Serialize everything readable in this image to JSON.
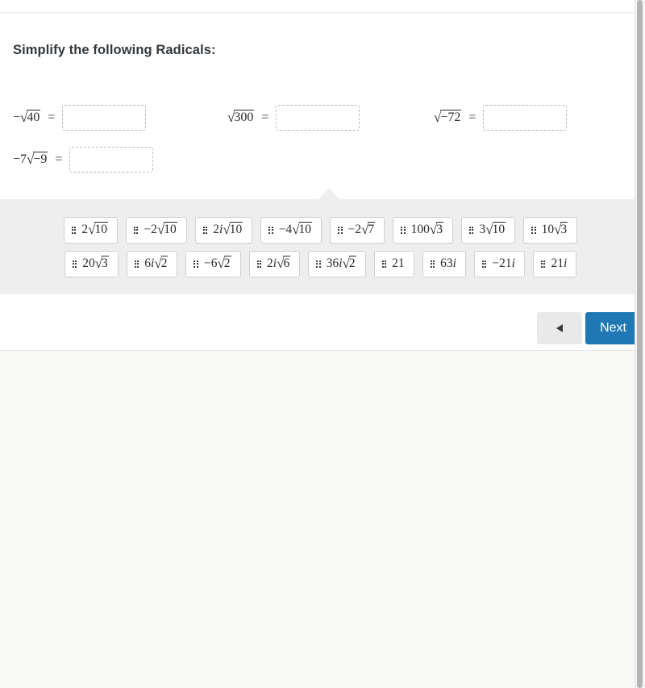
{
  "prompt": "Simplify the following Radicals:",
  "equations": [
    {
      "id": "eq1",
      "lhs_prefix": "−",
      "radicand": "40",
      "equals": "=",
      "answer": "",
      "placeholder": ""
    },
    {
      "id": "eq2",
      "lhs_prefix": "",
      "radicand": "300",
      "equals": "=",
      "answer": "",
      "placeholder": ""
    },
    {
      "id": "eq3",
      "lhs_prefix": "",
      "radicand": "−72",
      "equals": "=",
      "answer": "",
      "placeholder": ""
    },
    {
      "id": "eq4",
      "lhs_prefix": "−7",
      "radicand": "−9",
      "equals": "=",
      "answer": "",
      "placeholder": ""
    }
  ],
  "answer_bank": {
    "rows": [
      [
        {
          "coef": "2",
          "imag": "",
          "radicand": "10"
        },
        {
          "coef": "−2",
          "imag": "",
          "radicand": "10"
        },
        {
          "coef": "2",
          "imag": "i",
          "radicand": "10"
        },
        {
          "coef": "−4",
          "imag": "",
          "radicand": "10"
        },
        {
          "coef": "−2",
          "imag": "",
          "radicand": "7"
        },
        {
          "coef": "100",
          "imag": "",
          "radicand": "3"
        },
        {
          "coef": "3",
          "imag": "",
          "radicand": "10"
        },
        {
          "coef": "10",
          "imag": "",
          "radicand": "3"
        }
      ],
      [
        {
          "coef": "20",
          "imag": "",
          "radicand": "3"
        },
        {
          "coef": "6",
          "imag": "i",
          "radicand": "2"
        },
        {
          "coef": "−6",
          "imag": "",
          "radicand": "2"
        },
        {
          "coef": "2",
          "imag": "i",
          "radicand": "6"
        },
        {
          "coef": "36",
          "imag": "i",
          "radicand": "2"
        },
        {
          "coef": "21",
          "imag": "",
          "radicand": ""
        },
        {
          "coef": "63",
          "imag": "i",
          "radicand": ""
        },
        {
          "coef": "−21",
          "imag": "i",
          "radicand": ""
        },
        {
          "coef": "21",
          "imag": "i",
          "radicand": ""
        }
      ]
    ],
    "handle_icon": "drag-handle-icon"
  },
  "navigation": {
    "prev_icon": "left-triangle-icon",
    "prev_label": "",
    "next_label": "Next"
  },
  "colors": {
    "accent_blue": "#1f78b4",
    "bank_bg": "#eeeeee",
    "card_bg": "#ffffff",
    "page_bg": "#f8f8f7",
    "blank_border": "#b9b9b9",
    "tile_border": "#cfcfcf",
    "text": "#2b2b2b"
  }
}
